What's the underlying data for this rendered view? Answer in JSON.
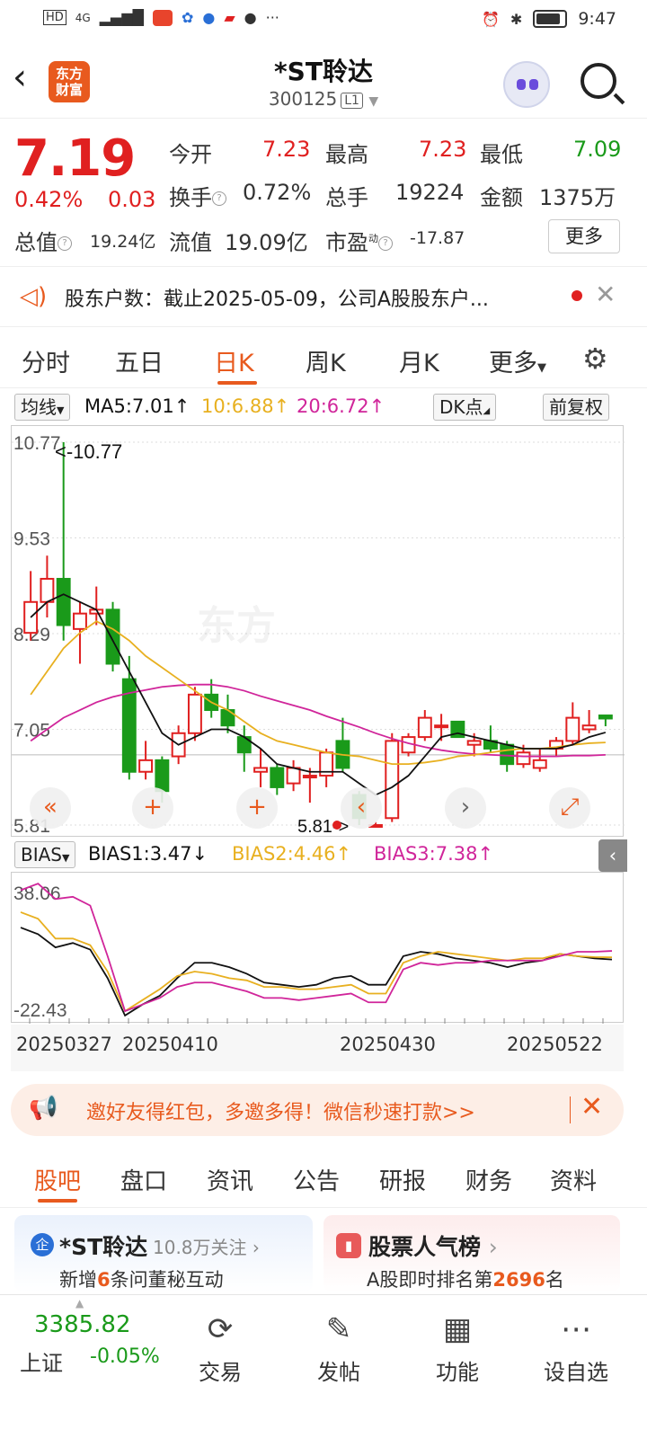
{
  "status_bar": {
    "time": "9:47",
    "network": "4G"
  },
  "header": {
    "logo_line1": "东方",
    "logo_line2": "财富",
    "title": "*ST聆达",
    "code": "300125",
    "level": "L1"
  },
  "quote": {
    "price": "7.19",
    "change_pct": "0.42%",
    "change_amt": "0.03",
    "open_label": "今开",
    "open": "7.23",
    "high_label": "最高",
    "high": "7.23",
    "low_label": "最低",
    "low": "7.09",
    "turnover_label": "换手",
    "turnover": "0.72%",
    "volume_label": "总手",
    "volume": "19224",
    "amount_label": "金额",
    "amount": "1375万",
    "mktcap_label": "总值",
    "mktcap": "19.24亿",
    "float_label": "流值",
    "float_cap": "19.09亿",
    "pe_label": "市盈",
    "pe_sup": "动",
    "pe": "-17.87",
    "more": "更多"
  },
  "notice": {
    "text": "股东户数：截止2025-05-09，公司A股股东户..."
  },
  "kline_tabs": [
    "分时",
    "五日",
    "日K",
    "周K",
    "月K",
    "更多"
  ],
  "kline_active": "日K",
  "ma_bar": {
    "selector": "均线",
    "ma5": "MA5:7.01",
    "ma10": "10:6.88",
    "ma20": "20:6.72",
    "dk": "DK点",
    "adjust": "前复权"
  },
  "bias_bar": {
    "selector": "BIAS",
    "bias1": "BIAS1:3.47",
    "bias2": "BIAS2:4.46",
    "bias3": "BIAS3:7.38"
  },
  "colors": {
    "up": "#e02020",
    "down": "#1a9a1a",
    "ma5": "#111111",
    "ma10": "#e8b020",
    "ma20": "#d0259a",
    "accent": "#e85a1e"
  },
  "chart_data": [
    {
      "type": "candlestick",
      "title": "",
      "y_ticks": [
        "10.77",
        "9.53",
        "8.29",
        "7.05",
        "5.81"
      ],
      "ylim": [
        5.81,
        10.77
      ],
      "annotations": [
        "<-10.77",
        "5.81->"
      ],
      "x_ticks": [
        "20250327",
        "20250410",
        "20250430",
        "20250522"
      ],
      "candles": [
        {
          "o": 8.3,
          "h": 9.1,
          "l": 8.2,
          "c": 8.7
        },
        {
          "o": 8.7,
          "h": 9.3,
          "l": 8.5,
          "c": 9.0
        },
        {
          "o": 9.0,
          "h": 10.77,
          "l": 8.2,
          "c": 8.4
        },
        {
          "o": 8.35,
          "h": 8.7,
          "l": 7.9,
          "c": 8.55
        },
        {
          "o": 8.55,
          "h": 8.9,
          "l": 8.4,
          "c": 8.6
        },
        {
          "o": 8.6,
          "h": 8.7,
          "l": 7.8,
          "c": 7.9
        },
        {
          "o": 7.7,
          "h": 8.0,
          "l": 6.4,
          "c": 6.5
        },
        {
          "o": 6.5,
          "h": 6.9,
          "l": 6.4,
          "c": 6.65
        },
        {
          "o": 6.65,
          "h": 6.7,
          "l": 6.1,
          "c": 6.25
        },
        {
          "o": 6.7,
          "h": 7.1,
          "l": 6.6,
          "c": 7.0
        },
        {
          "o": 7.0,
          "h": 7.6,
          "l": 6.9,
          "c": 7.5
        },
        {
          "o": 7.5,
          "h": 7.7,
          "l": 7.2,
          "c": 7.3
        },
        {
          "o": 7.3,
          "h": 7.5,
          "l": 7.0,
          "c": 7.1
        },
        {
          "o": 6.95,
          "h": 7.1,
          "l": 6.5,
          "c": 6.75
        },
        {
          "o": 6.5,
          "h": 6.8,
          "l": 6.3,
          "c": 6.55
        },
        {
          "o": 6.55,
          "h": 6.6,
          "l": 6.2,
          "c": 6.3
        },
        {
          "o": 6.35,
          "h": 6.65,
          "l": 6.25,
          "c": 6.55
        },
        {
          "o": 6.45,
          "h": 6.55,
          "l": 6.1,
          "c": 6.45
        },
        {
          "o": 6.45,
          "h": 6.8,
          "l": 6.3,
          "c": 6.75
        },
        {
          "o": 6.9,
          "h": 7.2,
          "l": 6.5,
          "c": 6.55
        },
        {
          "o": 6.2,
          "h": 6.25,
          "l": 5.81,
          "c": 5.9
        },
        {
          "o": 5.81,
          "h": 5.85,
          "l": 5.81,
          "c": 5.81
        },
        {
          "o": 5.9,
          "h": 7.0,
          "l": 5.85,
          "c": 6.9
        },
        {
          "o": 6.75,
          "h": 7.0,
          "l": 6.7,
          "c": 6.95
        },
        {
          "o": 6.95,
          "h": 7.3,
          "l": 6.9,
          "c": 7.2
        },
        {
          "o": 7.1,
          "h": 7.25,
          "l": 6.9,
          "c": 7.1
        },
        {
          "o": 7.15,
          "h": 7.1,
          "l": 6.95,
          "c": 6.95
        },
        {
          "o": 6.85,
          "h": 7.0,
          "l": 6.7,
          "c": 6.9
        },
        {
          "o": 6.9,
          "h": 7.1,
          "l": 6.75,
          "c": 6.8
        },
        {
          "o": 6.85,
          "h": 6.9,
          "l": 6.5,
          "c": 6.6
        },
        {
          "o": 6.6,
          "h": 6.85,
          "l": 6.55,
          "c": 6.75
        },
        {
          "o": 6.55,
          "h": 6.8,
          "l": 6.5,
          "c": 6.65
        },
        {
          "o": 6.8,
          "h": 6.95,
          "l": 6.7,
          "c": 6.9
        },
        {
          "o": 6.9,
          "h": 7.4,
          "l": 6.85,
          "c": 7.2
        },
        {
          "o": 7.05,
          "h": 7.3,
          "l": 7.0,
          "c": 7.1
        },
        {
          "o": 7.23,
          "h": 7.23,
          "l": 7.09,
          "c": 7.19
        }
      ],
      "ma5": [
        8.5,
        8.7,
        8.8,
        8.7,
        8.6,
        8.2,
        7.8,
        7.4,
        7.0,
        6.85,
        6.95,
        7.05,
        7.05,
        6.95,
        6.8,
        6.6,
        6.55,
        6.5,
        6.5,
        6.5,
        6.35,
        6.2,
        6.3,
        6.45,
        6.7,
        6.95,
        7.0,
        6.95,
        6.9,
        6.85,
        6.8,
        6.8,
        6.8,
        6.85,
        6.95,
        7.01
      ],
      "ma10": [
        7.5,
        7.8,
        8.1,
        8.3,
        8.45,
        8.35,
        8.2,
        8.0,
        7.85,
        7.7,
        7.55,
        7.4,
        7.3,
        7.15,
        7.0,
        6.9,
        6.85,
        6.8,
        6.75,
        6.72,
        6.7,
        6.65,
        6.6,
        6.6,
        6.62,
        6.65,
        6.7,
        6.72,
        6.75,
        6.78,
        6.8,
        6.8,
        6.82,
        6.85,
        6.87,
        6.88
      ],
      "ma20": [
        6.9,
        7.05,
        7.2,
        7.3,
        7.4,
        7.47,
        7.52,
        7.56,
        7.6,
        7.62,
        7.63,
        7.63,
        7.6,
        7.55,
        7.48,
        7.42,
        7.36,
        7.3,
        7.22,
        7.15,
        7.08,
        7.0,
        6.93,
        6.87,
        6.82,
        6.78,
        6.75,
        6.73,
        6.72,
        6.71,
        6.7,
        6.7,
        6.7,
        6.71,
        6.71,
        6.72
      ]
    },
    {
      "type": "line",
      "title": "BIAS",
      "y_ticks": [
        "38.06",
        "-22.43"
      ],
      "ylim": [
        -22.43,
        38.06
      ],
      "series": [
        {
          "name": "BIAS1",
          "values": [
            18,
            15,
            9,
            11,
            8,
            -5,
            -22,
            -17,
            -13,
            -5,
            2,
            2,
            0,
            -3,
            -7,
            -8,
            -9,
            -8,
            -5,
            -4,
            -8,
            -8,
            5,
            7,
            6,
            4,
            3,
            2,
            0,
            2,
            3,
            6,
            5,
            4,
            3.47
          ]
        },
        {
          "name": "BIAS2",
          "values": [
            25,
            22,
            13,
            13,
            10,
            -2,
            -20,
            -15,
            -10,
            -4,
            -2,
            -3,
            -5,
            -6,
            -9,
            -9,
            -10,
            -10,
            -9,
            -8,
            -12,
            -12,
            2,
            5,
            7,
            6,
            5,
            4,
            3,
            4,
            4,
            6,
            5,
            4.6,
            4.46
          ]
        },
        {
          "name": "BIAS3",
          "values": [
            35,
            38,
            31,
            32,
            28,
            5,
            -20,
            -17,
            -14,
            -9,
            -7,
            -7,
            -9,
            -11,
            -14,
            -14,
            -15,
            -14,
            -13,
            -12,
            -16,
            -16,
            -1,
            2,
            1,
            2,
            2,
            3,
            3,
            3,
            3,
            5,
            7,
            7,
            7.38
          ]
        }
      ]
    }
  ],
  "promo": {
    "text": "邀好友得红包，多邀多得！微信秒速打款>>"
  },
  "bottom_tabs": [
    "股吧",
    "盘口",
    "资讯",
    "公告",
    "研报",
    "财务",
    "资料"
  ],
  "cards": {
    "left_title": "*ST聆达",
    "left_follow": "10.8万关注",
    "left_sub_pre": "新增",
    "left_sub_num": "6",
    "left_sub_post": "条问董秘互动",
    "right_title": "股票人气榜",
    "right_sub_pre": "A股即时排名第",
    "right_sub_num": "2696",
    "right_sub_post": "名"
  },
  "footer": {
    "index_value": "3385.82",
    "index_name": "上证",
    "index_change": "-0.05%",
    "trade": "交易",
    "post": "发帖",
    "functions": "功能",
    "watch": "设自选"
  }
}
